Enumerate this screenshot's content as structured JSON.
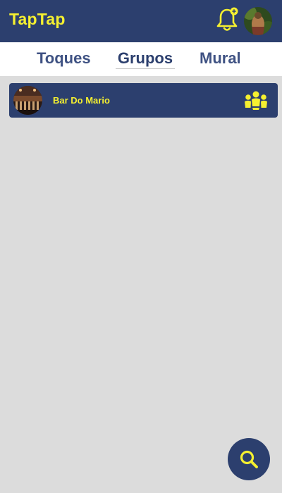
{
  "app": {
    "title": "TapTap"
  },
  "header": {
    "notification_icon": "bell-plus-icon",
    "avatar": "user-avatar"
  },
  "tabs": [
    {
      "label": "Toques",
      "active": false
    },
    {
      "label": "Grupos",
      "active": true
    },
    {
      "label": "Mural",
      "active": false
    }
  ],
  "groups": [
    {
      "name": "Bar Do Mario",
      "icon": "group-members-icon"
    }
  ],
  "fab": {
    "icon": "search-icon"
  },
  "colors": {
    "primary": "#2c3f6e",
    "accent": "#f5f030",
    "background": "#dcdcdc",
    "tab_text": "#3f5283"
  }
}
